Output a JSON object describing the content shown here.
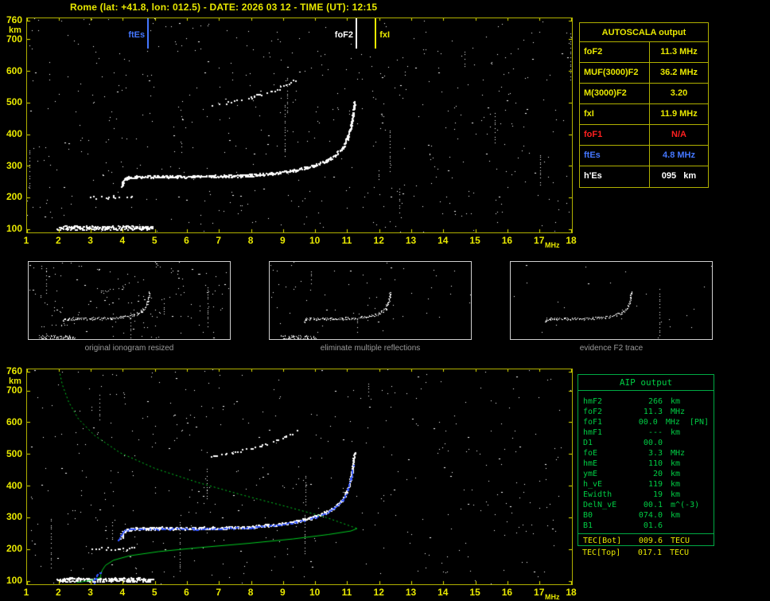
{
  "header": {
    "title": "Rome (lat: +41.8, lon: 012.5) - DATE: 2026 03 12 - TIME (UT): 12:15"
  },
  "autoscala": {
    "title": "AUTOSCALA output",
    "rows": [
      {
        "label": "foF2",
        "value": "11.3 MHz",
        "color": "#e8e800"
      },
      {
        "label": "MUF(3000)F2",
        "value": "36.2 MHz",
        "color": "#e8e800"
      },
      {
        "label": "M(3000)F2",
        "value": "3.20",
        "color": "#e8e800"
      },
      {
        "label": "fxI",
        "value": "11.9 MHz",
        "color": "#e8e800"
      },
      {
        "label": "foF1",
        "value": "N/A",
        "color": "#ff2020"
      },
      {
        "label": "ftEs",
        "value": "4.8 MHz",
        "color": "#4477ff"
      },
      {
        "label": "h'Es",
        "value": "095   km",
        "color": "#ffffff"
      }
    ]
  },
  "aip": {
    "title": "AIP output",
    "rows": [
      {
        "label": "hmF2",
        "value": "266",
        "unit": "km"
      },
      {
        "label": "foF2",
        "value": "11.3",
        "unit": "MHz"
      },
      {
        "label": "foF1",
        "value": "00.0",
        "unit": "MHz",
        "note": "[PN]"
      },
      {
        "label": "hmF1",
        "value": "---",
        "unit": "km"
      },
      {
        "label": "D1",
        "value": "00.0",
        "unit": ""
      },
      {
        "label": "foE",
        "value": "3.3",
        "unit": "MHz"
      },
      {
        "label": "hmE",
        "value": "110",
        "unit": "km"
      },
      {
        "label": "ymE",
        "value": "20",
        "unit": "km"
      },
      {
        "label": "h_vE",
        "value": "119",
        "unit": "km"
      },
      {
        "label": "Ewidth",
        "value": "19",
        "unit": "km"
      },
      {
        "label": "DelN_vE",
        "value": "00.1",
        "unit": "m^(-3)"
      },
      {
        "label": "B0",
        "value": "074.0",
        "unit": "km"
      },
      {
        "label": "B1",
        "value": "01.6",
        "unit": ""
      }
    ],
    "tec_rows": [
      {
        "label": "TEC[Bot]",
        "value": "009.6",
        "unit": "TECU"
      },
      {
        "label": "TEC[Top]",
        "value": "017.1",
        "unit": "TECU"
      }
    ]
  },
  "thumbnails": [
    {
      "caption": "original ionogram resized"
    },
    {
      "caption": "eliminate multiple reflections"
    },
    {
      "caption": "evidence F2 trace"
    }
  ],
  "markers": [
    {
      "label": "ftEs",
      "freq": 4.8,
      "color": "#4477ff",
      "align": "before"
    },
    {
      "label": "foF2",
      "freq": 11.3,
      "color": "#ffffff",
      "align": "before"
    },
    {
      "label": "fxI",
      "freq": 11.9,
      "color": "#e8e800",
      "align": "after"
    }
  ],
  "axes": {
    "x_ticks": [
      1,
      2,
      3,
      4,
      5,
      6,
      7,
      8,
      9,
      10,
      11,
      12,
      13,
      14,
      15,
      16,
      17,
      18
    ],
    "x_unit": "MHz",
    "y_ticks": [
      760,
      700,
      600,
      500,
      400,
      300,
      200,
      100
    ],
    "y_unit": "km"
  },
  "chart_data": {
    "type": "scatter",
    "title": "ionograms (virtual height km vs frequency MHz)",
    "xlabel": "MHz",
    "ylabel": "km",
    "xlim": [
      1,
      18
    ],
    "ylim": [
      90,
      768
    ],
    "grid": false,
    "colors": {
      "axis": "#e8e800",
      "border": "#b0b000",
      "trace": "#ffffff",
      "profile": "#00cc22",
      "fitted": "#3355ff"
    },
    "traces": {
      "es_layer": [
        [
          1.95,
          104
        ],
        [
          2.6,
          105
        ],
        [
          3.4,
          104
        ],
        [
          4.2,
          105
        ],
        [
          4.9,
          103
        ]
      ],
      "es_second_hop": [
        [
          3.0,
          201
        ],
        [
          3.7,
          203
        ],
        [
          4.35,
          202
        ]
      ],
      "f_trace": [
        [
          3.95,
          238
        ],
        [
          4.0,
          252
        ],
        [
          4.1,
          262
        ],
        [
          4.4,
          266
        ],
        [
          5.2,
          267
        ],
        [
          6.2,
          267
        ],
        [
          7.2,
          268
        ],
        [
          8.0,
          271
        ],
        [
          8.8,
          278
        ],
        [
          9.4,
          288
        ],
        [
          9.9,
          300
        ],
        [
          10.3,
          315
        ],
        [
          10.6,
          333
        ],
        [
          10.85,
          358
        ],
        [
          11.0,
          390
        ],
        [
          11.1,
          425
        ],
        [
          11.17,
          465
        ],
        [
          11.22,
          505
        ]
      ],
      "f_second_hop": [
        [
          6.75,
          492
        ],
        [
          7.4,
          505
        ],
        [
          8.0,
          518
        ],
        [
          8.6,
          536
        ],
        [
          9.1,
          556
        ],
        [
          9.4,
          575
        ]
      ],
      "fitted_trace": [
        [
          3.85,
          228
        ],
        [
          3.92,
          244
        ],
        [
          4.02,
          258
        ],
        [
          4.3,
          264
        ],
        [
          5.2,
          265
        ],
        [
          6.2,
          265
        ],
        [
          7.2,
          266
        ],
        [
          8.0,
          269
        ],
        [
          8.8,
          276
        ],
        [
          9.4,
          286
        ],
        [
          9.9,
          298
        ],
        [
          10.3,
          313
        ],
        [
          10.6,
          331
        ],
        [
          10.85,
          356
        ],
        [
          11.0,
          388
        ],
        [
          11.1,
          423
        ],
        [
          11.18,
          463
        ]
      ],
      "e_fit": [
        [
          3.05,
          93
        ],
        [
          3.12,
          105
        ],
        [
          3.18,
          116
        ],
        [
          3.28,
          128
        ]
      ],
      "profile_topside": [
        [
          2.0,
          766
        ],
        [
          2.1,
          720
        ],
        [
          2.3,
          665
        ],
        [
          2.6,
          612
        ],
        [
          3.1,
          560
        ],
        [
          3.9,
          505
        ],
        [
          5.0,
          455
        ],
        [
          6.3,
          412
        ],
        [
          7.7,
          372
        ],
        [
          9.1,
          335
        ],
        [
          10.3,
          302
        ],
        [
          11.05,
          275
        ],
        [
          11.3,
          266
        ]
      ],
      "profile_bottomside": [
        [
          11.3,
          266
        ],
        [
          11.1,
          258
        ],
        [
          10.4,
          247
        ],
        [
          9.3,
          233
        ],
        [
          7.9,
          219
        ],
        [
          6.4,
          206
        ],
        [
          5.1,
          193
        ],
        [
          4.2,
          180
        ],
        [
          3.7,
          166
        ],
        [
          3.45,
          150
        ],
        [
          3.35,
          135
        ],
        [
          3.3,
          122
        ],
        [
          3.3,
          112
        ],
        [
          3.15,
          106
        ],
        [
          2.85,
          100
        ],
        [
          2.55,
          95
        ]
      ]
    },
    "plots": {
      "top": {
        "canvas": "top-canvas",
        "seed": 41,
        "noise": 520,
        "streaks": 10,
        "ticks": true,
        "traces": [
          "es_layer",
          "es_second_hop",
          "f_trace",
          "f_second_hop"
        ]
      },
      "bottom": {
        "canvas": "bottom-canvas",
        "seed": 97,
        "noise": 430,
        "streaks": 8,
        "ticks": true,
        "traces": [
          "es_layer",
          "es_second_hop",
          "f_trace",
          "f_second_hop"
        ],
        "profile": true,
        "fitted": true
      },
      "thumb1": {
        "canvas": "thumb-canvas-1",
        "seed": 11,
        "noise": 150,
        "streaks": 4,
        "dot": 1,
        "traces": [
          "es_layer",
          "es_second_hop",
          "f_trace",
          "f_second_hop"
        ]
      },
      "thumb2": {
        "canvas": "thumb-canvas-2",
        "seed": 22,
        "noise": 60,
        "streaks": 2,
        "dot": 1,
        "traces": [
          "es_layer",
          "f_trace"
        ]
      },
      "thumb3": {
        "canvas": "thumb-canvas-3",
        "seed": 33,
        "noise": 25,
        "streaks": 1,
        "dot": 1,
        "traces": [
          "f_trace"
        ]
      }
    }
  }
}
